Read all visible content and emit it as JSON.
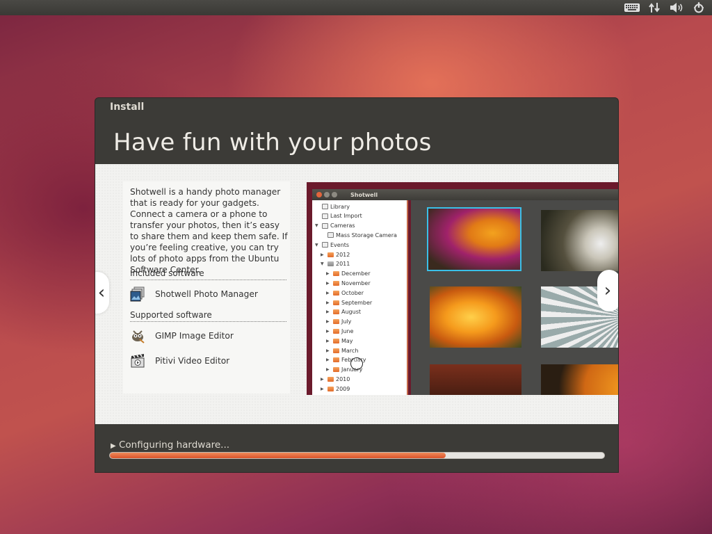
{
  "top_panel": {
    "icons": [
      "keyboard-icon",
      "network-icon",
      "volume-icon",
      "power-icon"
    ]
  },
  "installer": {
    "window_title": "Install",
    "headline": "Have fun with your photos",
    "description": "Shotwell is a handy photo manager that is ready for your gadgets. Connect a camera or a phone to transfer your photos, then it’s easy to share them and keep them safe. If you’re feeling creative, you can try lots of photo apps from the Ubuntu Software Center.",
    "included_heading": "Included software",
    "included": [
      {
        "label": "Shotwell Photo Manager",
        "icon": "shotwell-icon"
      }
    ],
    "supported_heading": "Supported software",
    "supported": [
      {
        "label": "GIMP Image Editor",
        "icon": "gimp-icon"
      },
      {
        "label": "Pitivi Video Editor",
        "icon": "pitivi-icon"
      }
    ],
    "prev_glyph": "‹",
    "next_glyph": "›",
    "progress_text": "Configuring hardware...",
    "progress_fraction": 0.68,
    "accent_color": "#e0603a"
  },
  "shotwell": {
    "title": "Shotwell",
    "tree": [
      {
        "label": "Library",
        "indent": 0,
        "icon": "library-icon",
        "tri": ""
      },
      {
        "label": "Last Import",
        "indent": 0,
        "icon": "clock-icon",
        "tri": ""
      },
      {
        "label": "Cameras",
        "indent": 0,
        "icon": "camera-icon",
        "tri": "▼"
      },
      {
        "label": "Mass Storage Camera",
        "indent": 1,
        "icon": "camera-icon",
        "tri": ""
      },
      {
        "label": "Events",
        "indent": 0,
        "icon": "events-icon",
        "tri": "▼"
      },
      {
        "label": "2012",
        "indent": 1,
        "icon": "folder-icon",
        "tri": "▶"
      },
      {
        "label": "2011",
        "indent": 1,
        "icon": "folder-grey-icon",
        "tri": "▼"
      },
      {
        "label": "December",
        "indent": 2,
        "icon": "folder-icon",
        "tri": "▶"
      },
      {
        "label": "November",
        "indent": 2,
        "icon": "folder-icon",
        "tri": "▶"
      },
      {
        "label": "October",
        "indent": 2,
        "icon": "folder-icon",
        "tri": "▶"
      },
      {
        "label": "September",
        "indent": 2,
        "icon": "folder-icon",
        "tri": "▶"
      },
      {
        "label": "August",
        "indent": 2,
        "icon": "folder-icon",
        "tri": "▶"
      },
      {
        "label": "July",
        "indent": 2,
        "icon": "folder-icon",
        "tri": "▶"
      },
      {
        "label": "June",
        "indent": 2,
        "icon": "folder-icon",
        "tri": "▶"
      },
      {
        "label": "May",
        "indent": 2,
        "icon": "folder-icon",
        "tri": "▶"
      },
      {
        "label": "March",
        "indent": 2,
        "icon": "folder-icon",
        "tri": "▶"
      },
      {
        "label": "February",
        "indent": 2,
        "icon": "folder-icon",
        "tri": "▶"
      },
      {
        "label": "January",
        "indent": 2,
        "icon": "folder-icon",
        "tri": "▶"
      },
      {
        "label": "2010",
        "indent": 1,
        "icon": "folder-icon",
        "tri": "▶"
      },
      {
        "label": "2009",
        "indent": 1,
        "icon": "folder-icon",
        "tri": "▶"
      }
    ],
    "thumbnails": [
      {
        "name": "thumb-purple-orange-flower",
        "selected": true
      },
      {
        "name": "thumb-white-flowers",
        "selected": false
      },
      {
        "name": "thumb-orange-flower",
        "selected": false
      },
      {
        "name": "thumb-ferris-wheel",
        "selected": false
      },
      {
        "name": "thumb-dark-red",
        "selected": false
      },
      {
        "name": "thumb-orange-texture",
        "selected": false
      }
    ]
  }
}
